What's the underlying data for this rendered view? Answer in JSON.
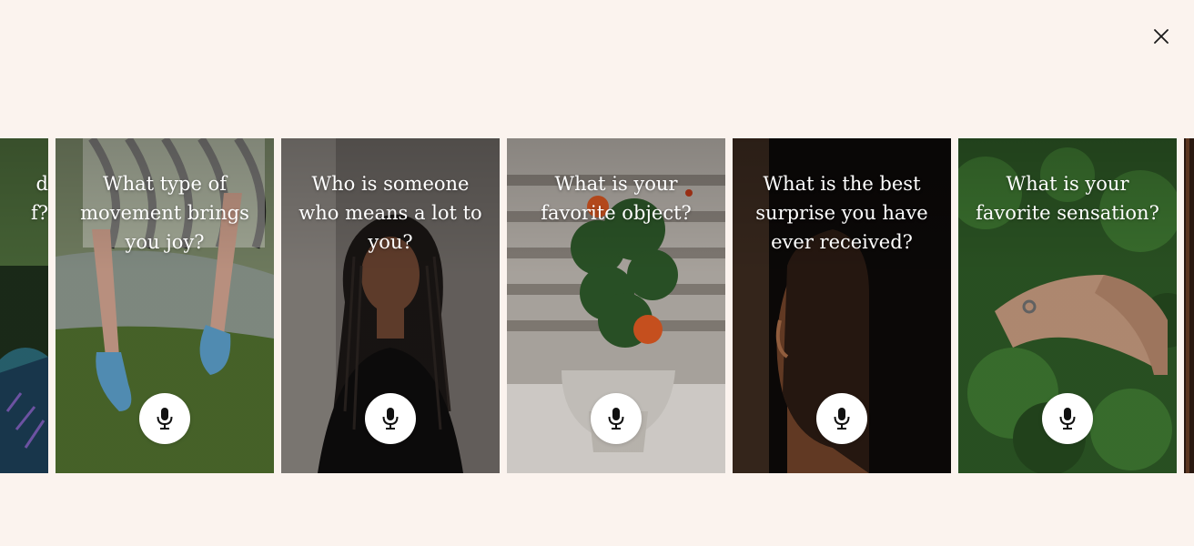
{
  "close": {
    "icon": "close-icon"
  },
  "cards": [
    {
      "question_fragment": "d\nf?",
      "icon": "microphone-icon"
    },
    {
      "question": "What type of movement brings you joy?",
      "icon": "microphone-icon"
    },
    {
      "question": "Who is someone who means a lot to you?",
      "icon": "microphone-icon"
    },
    {
      "question": "What is your favorite object?",
      "icon": "microphone-icon"
    },
    {
      "question": "What is the best surprise you have ever received?",
      "icon": "microphone-icon"
    },
    {
      "question": "What is your favorite sensation?",
      "icon": "microphone-icon"
    }
  ],
  "colors": {
    "background": "#FBF3EE",
    "text_on_card": "#FFFFFF",
    "mic_button": "#FFFFFF"
  }
}
